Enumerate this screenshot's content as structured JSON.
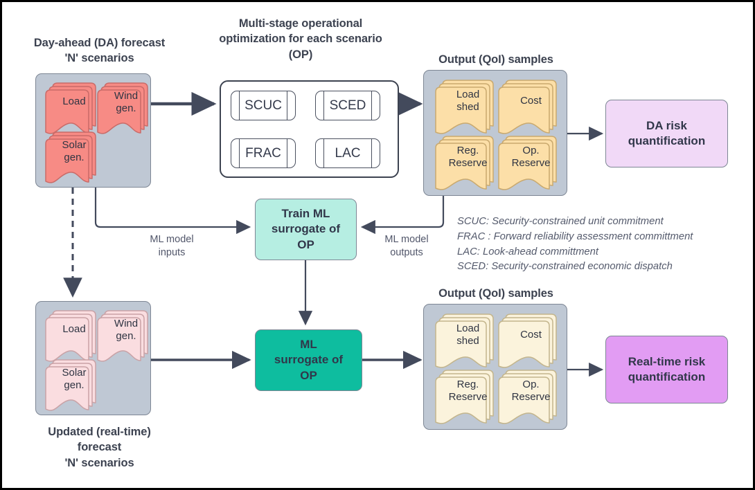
{
  "headings": {
    "da_forecast": "Day-ahead (DA) forecast\n'N' scenarios",
    "op": "Multi-stage operational\noptimization for each scenario\n(OP)",
    "output_top": "Output (QoI) samples",
    "output_bottom": "Output (QoI) samples",
    "rt_forecast": "Updated (real-time)\nforecast\n'N' scenarios"
  },
  "da_scenarios": {
    "docs": [
      {
        "label": "Load"
      },
      {
        "label": "Wind\ngen."
      },
      {
        "label": "Solar\ngen."
      }
    ],
    "doc_fill": "#f78b85",
    "doc_stroke": "#c96b68"
  },
  "rt_scenarios": {
    "docs": [
      {
        "label": "Load"
      },
      {
        "label": "Wind\ngen."
      },
      {
        "label": "Solar\ngen."
      }
    ],
    "doc_fill": "#fadde0",
    "doc_stroke": "#c9a2a6"
  },
  "output_top": {
    "docs": [
      {
        "label": "Load\nshed"
      },
      {
        "label": "Cost"
      },
      {
        "label": "Reg.\nReserve"
      },
      {
        "label": "Op.\nReserve"
      }
    ],
    "doc_fill": "#fcdfa8",
    "doc_stroke": "#c9a96e"
  },
  "output_bottom": {
    "docs": [
      {
        "label": "Load\nshed"
      },
      {
        "label": "Cost"
      },
      {
        "label": "Reg.\nReserve"
      },
      {
        "label": "Op.\nReserve"
      }
    ],
    "doc_fill": "#fbf3dc",
    "doc_stroke": "#c3b58c"
  },
  "op_stages": [
    {
      "id": "scuc",
      "label": "SCUC"
    },
    {
      "id": "sced",
      "label": "SCED"
    },
    {
      "id": "frac",
      "label": "FRAC"
    },
    {
      "id": "lac",
      "label": "LAC"
    }
  ],
  "boxes": {
    "train_ml": "Train ML\nsurrogate of\nOP",
    "ml_surrogate": "ML\nsurrogate of\nOP",
    "da_risk": "DA risk\nquantification",
    "rt_risk": "Real-time risk\nquantification"
  },
  "edge_labels": {
    "ml_inputs": "ML model\ninputs",
    "ml_outputs": "ML model\noutputs"
  },
  "legend": [
    "SCUC: Security-constrained unit commitment",
    "FRAC : Forward reliability assessment committment",
    "LAC: Look-ahead committment",
    "SCED: Security-constrained economic dispatch"
  ],
  "colors": {
    "group_fill": "#bfc8d4",
    "group_stroke": "#7d8694",
    "connector": "#434a5c",
    "train_ml_fill": "#b6eee2",
    "ml_surrogate_fill": "#0ebd9f",
    "da_risk_fill": "#f1d9f7",
    "rt_risk_fill": "#e29cf3",
    "text": "#3c4250"
  }
}
